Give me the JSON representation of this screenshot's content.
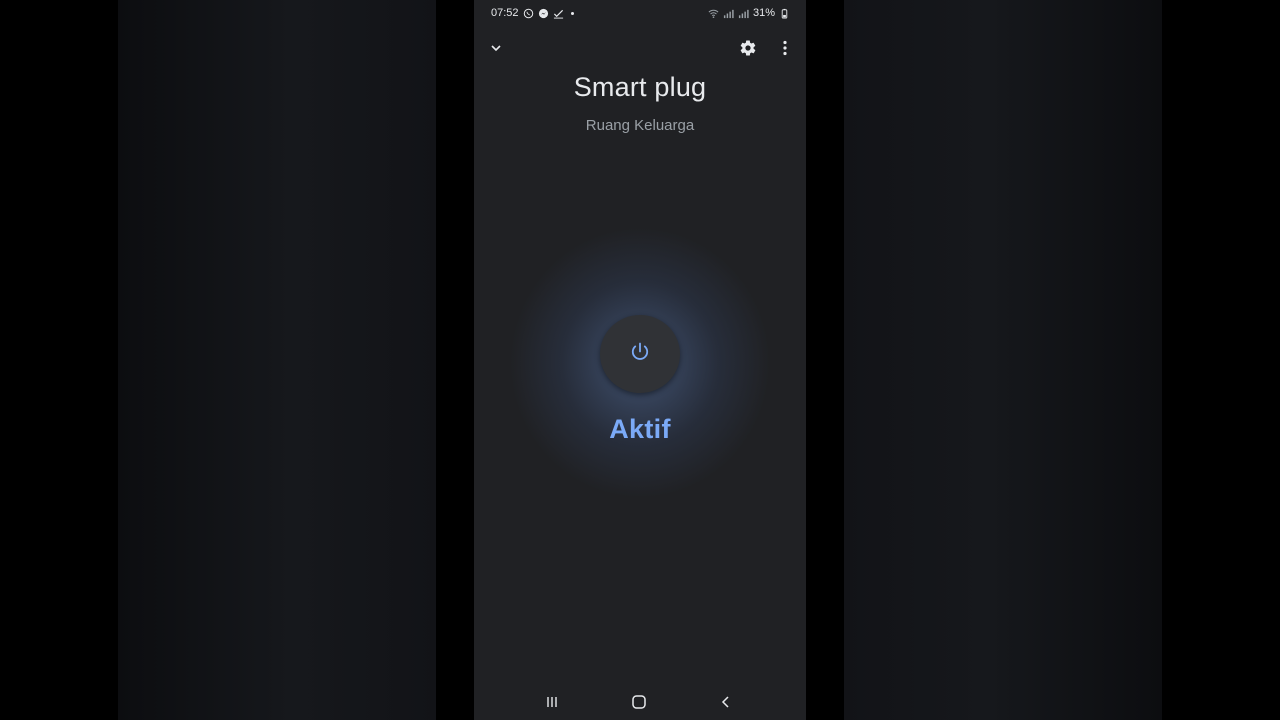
{
  "status_bar": {
    "time": "07:52",
    "battery": "31%",
    "icons": [
      "whatsapp-icon",
      "messenger-icon",
      "check-icon",
      "notification-dot",
      "wifi-icon",
      "signal-icon",
      "signal-icon",
      "battery-icon"
    ]
  },
  "header": {
    "collapse_icon": "chevron-down-icon",
    "settings_icon": "gear-icon",
    "more_icon": "more-vert-icon"
  },
  "device": {
    "name": "Smart plug",
    "room": "Ruang Keluarga",
    "state_label": "Aktif",
    "power_icon": "power-icon"
  },
  "nav_bar": {
    "recents_icon": "recents-icon",
    "home_icon": "home-icon",
    "back_icon": "back-icon"
  },
  "colors": {
    "background": "#202124",
    "accent": "#7baaf7",
    "text_primary": "#e8eaed",
    "text_secondary": "#9aa0a6"
  }
}
